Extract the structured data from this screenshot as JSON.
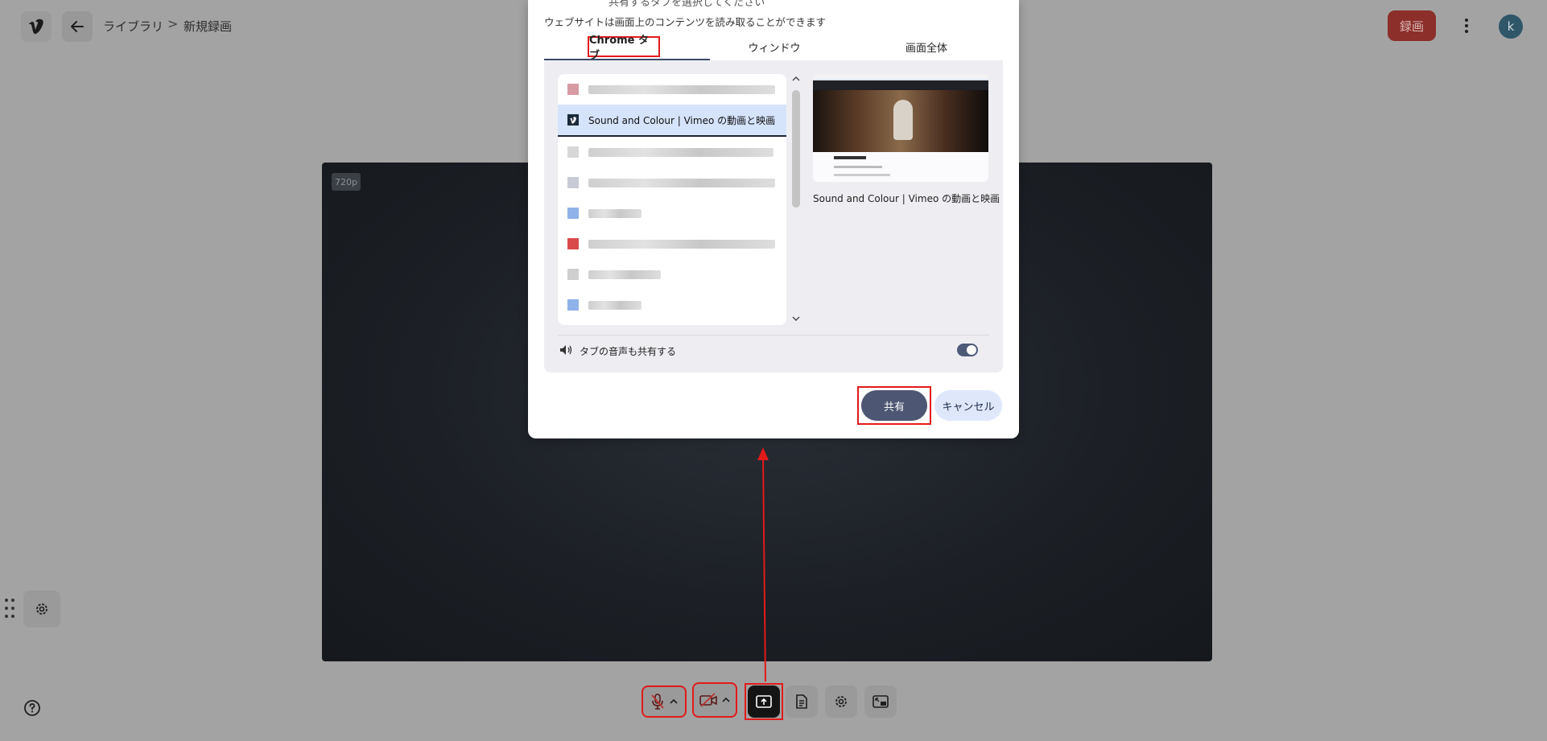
{
  "topbar": {
    "breadcrumb": [
      "ライブラリ",
      "新規録画"
    ],
    "breadcrumb_sep": ">",
    "record_label": "録画",
    "avatar_initial": "k"
  },
  "preview": {
    "resolution_badge": "720p"
  },
  "toolbar": {
    "items": [
      "microphone-muted",
      "camera-off",
      "share-screen",
      "notes",
      "settings",
      "picture-in-picture"
    ]
  },
  "dialog": {
    "clipped_title": "共有するタブを選択してください",
    "subtitle": "ウェブサイトは画面上のコンテンツを読み取ることができます",
    "tabs": [
      {
        "label": "Chrome タブ",
        "active": true
      },
      {
        "label": "ウィンドウ",
        "active": false
      },
      {
        "label": "画面全体",
        "active": false
      }
    ],
    "list": {
      "selected_tab_title": "Sound and Colour | Vimeo の動画と映画"
    },
    "preview_caption": "Sound and Colour | Vimeo の動画と映画",
    "audio_share_label": "タブの音声も共有する",
    "audio_share_on": true,
    "share_label": "共有",
    "cancel_label": "キャンセル"
  },
  "colors": {
    "accent": "#4d5672",
    "highlight": "#e21a1a",
    "selected_row": "#d5e3fb"
  }
}
